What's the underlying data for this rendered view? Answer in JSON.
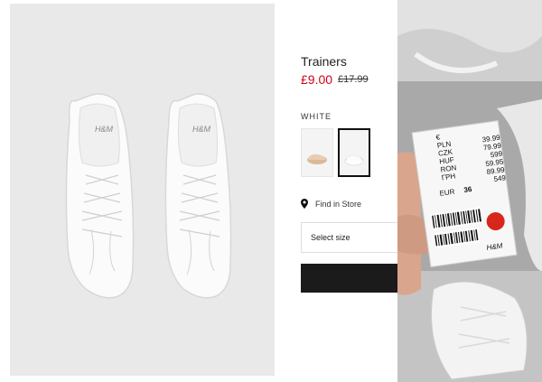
{
  "product": {
    "title": "Trainers",
    "price": "£9.00",
    "old_price": "£17.99",
    "color_label": "WHITE",
    "find_in_store": "Find in Store",
    "size_placeholder": "Select size",
    "add_button_label": ""
  },
  "product_image": {
    "brand_mark": "H&M"
  },
  "price_tag": {
    "currencies": [
      "€",
      "PLN",
      "CZK",
      "HUF",
      "RON",
      "ГРН"
    ],
    "amounts": [
      "",
      "39.99",
      "79.99",
      "599",
      "59.95",
      "89.99",
      "549"
    ],
    "size_label": "EUR",
    "size_value": "36",
    "brand": "H&M"
  },
  "colors": {
    "price_red": "#d0021b",
    "button_black": "#1b1b1b",
    "tag_sticker_red": "#d9261c"
  },
  "icons": {
    "store": "map-pin-icon"
  }
}
